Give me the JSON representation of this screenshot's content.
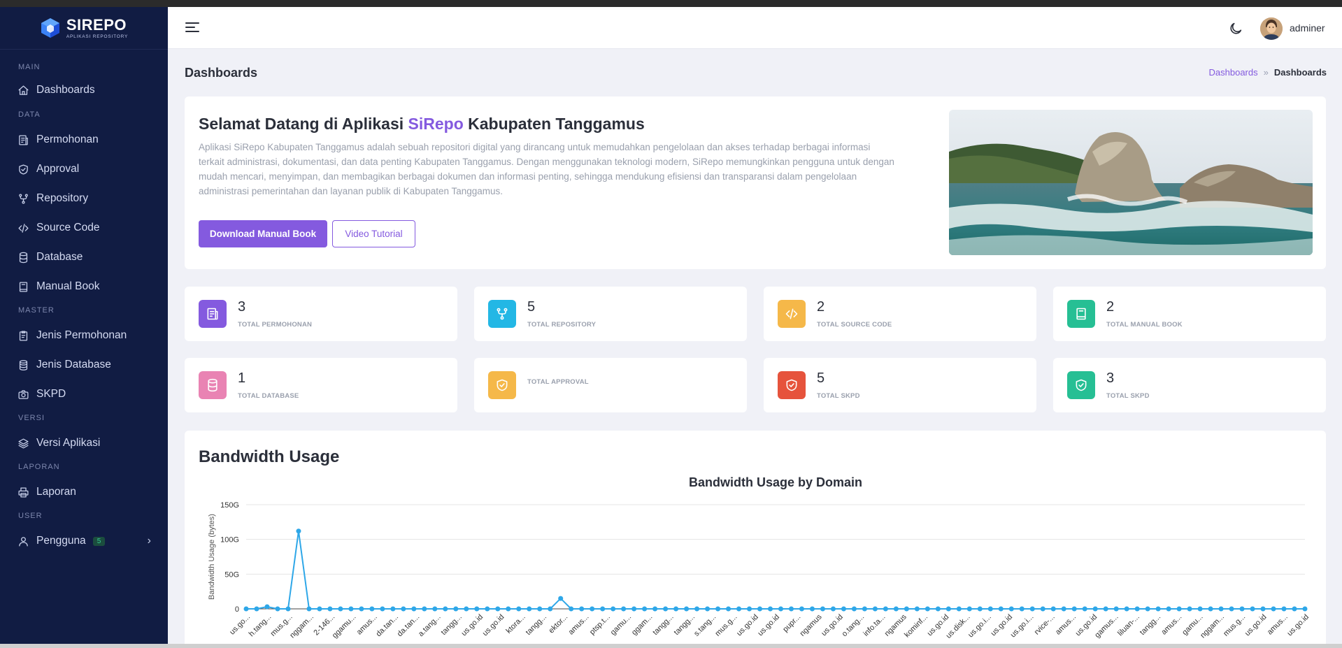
{
  "sidebar": {
    "brand": {
      "name": "SIREPO",
      "sub": "APLIKASI REPOSITORY"
    },
    "sections": {
      "main": "MAIN",
      "data": "DATA",
      "master": "MASTER",
      "versi": "VERSI",
      "laporan": "LAPORAN",
      "user": "USER"
    },
    "items": {
      "dashboards": "Dashboards",
      "permohonan": "Permohonan",
      "approval": "Approval",
      "repository": "Repository",
      "source_code": "Source Code",
      "database": "Database",
      "manual_book": "Manual Book",
      "jenis_permohonan": "Jenis Permohonan",
      "jenis_database": "Jenis Database",
      "skpd": "SKPD",
      "versi_aplikasi": "Versi Aplikasi",
      "laporan": "Laporan",
      "pengguna": "Pengguna"
    },
    "pengguna_badge": "5"
  },
  "header": {
    "username": "adminer"
  },
  "page": {
    "title": "Dashboards",
    "breadcrumb": {
      "link": "Dashboards",
      "separator": "»",
      "current": "Dashboards"
    }
  },
  "welcome": {
    "title_prefix": "Selamat Datang di Aplikasi ",
    "title_accent": "SiRepo",
    "title_suffix": " Kabupaten Tanggamus",
    "description": "Aplikasi SiRepo Kabupaten Tanggamus adalah sebuah repositori digital yang dirancang untuk memudahkan pengelolaan dan akses terhadap berbagai informasi terkait administrasi, dokumentasi, dan data penting Kabupaten Tanggamus. Dengan menggunakan teknologi modern, SiRepo memungkinkan pengguna untuk dengan mudah mencari, menyimpan, dan membagikan berbagai dokumen dan informasi penting, sehingga mendukung efisiensi dan transparansi dalam pengelolaan administrasi pemerintahan dan layanan publik di Kabupaten Tanggamus.",
    "download_button": "Download Manual Book",
    "video_button": "Video Tutorial"
  },
  "stats": [
    {
      "value": "3",
      "label": "TOTAL PERMOHONAN",
      "color": "#845adf",
      "icon": "file-text-icon"
    },
    {
      "value": "5",
      "label": "TOTAL REPOSITORY",
      "color": "#23b7e5",
      "icon": "git-fork-icon"
    },
    {
      "value": "2",
      "label": "TOTAL SOURCE CODE",
      "color": "#f5b849",
      "icon": "code-icon"
    },
    {
      "value": "2",
      "label": "TOTAL MANUAL BOOK",
      "color": "#26bf94",
      "icon": "book-icon"
    },
    {
      "value": "1",
      "label": "TOTAL DATABASE",
      "color": "#e983b3",
      "icon": "database-icon"
    },
    {
      "value": "",
      "label": "TOTAL APPROVAL",
      "color": "#f5b849",
      "icon": "shield-check-icon"
    },
    {
      "value": "5",
      "label": "TOTAL SKPD",
      "color": "#e6533c",
      "icon": "shield-check-icon"
    },
    {
      "value": "3",
      "label": "TOTAL SKPD",
      "color": "#26bf94",
      "icon": "shield-check-icon"
    }
  ],
  "chart_section": {
    "heading": "Bandwidth Usage"
  },
  "chart_data": {
    "type": "line",
    "title": "Bandwidth Usage by Domain",
    "xlabel": "",
    "ylabel": "Bandwidth Usage (bytes)",
    "yticks": [
      "0",
      "50G",
      "100G",
      "150G"
    ],
    "ylim": [
      0,
      150
    ],
    "unit": "G",
    "color": "#2ea7e8",
    "categories": [
      "us.go...",
      "h.tang...",
      "mus.g...",
      "nggam...",
      "2-146...",
      "ggamu...",
      "amus...",
      "da.tan...",
      "da.tan...",
      "a.tang...",
      "tangg...",
      "us.go.id",
      "us.go.id",
      "ktora...",
      "tangg...",
      "ektor...",
      "amus...",
      "ptsp.t...",
      "gamu...",
      "ggam...",
      "tangg...",
      "tangg...",
      "s.tang...",
      "mus.g...",
      "us.go.id",
      "us.go.id",
      "pupr...",
      "ngamus",
      "us.go.id",
      "o.tang...",
      "info.ta...",
      "ngamus",
      "kominf...",
      "us.go.id",
      "us.disk...",
      "us.go.i...",
      "us.go.id",
      "us.go.i...",
      "rvice-...",
      "amus...",
      "us.go.id",
      "gamus...",
      "liluan-...",
      "tangg...",
      "amus...",
      "gamu...",
      "nggam...",
      "mus.g...",
      "us.go.id",
      "amus...",
      "us.go.id"
    ],
    "values": [
      0,
      0,
      3,
      0,
      0,
      112,
      0,
      0,
      0,
      0,
      0,
      0,
      0,
      0,
      0,
      0,
      0,
      0,
      0,
      0,
      0,
      0,
      0,
      0,
      0,
      0,
      0,
      0,
      0,
      0,
      15,
      0,
      0,
      0,
      0,
      0,
      0,
      0,
      0,
      0,
      0,
      0,
      0,
      0,
      0,
      0,
      0,
      0,
      0,
      0,
      0,
      0,
      0,
      0,
      0,
      0,
      0,
      0,
      0,
      0,
      0,
      0,
      0,
      0,
      0,
      0,
      0,
      0,
      0,
      0,
      0,
      0,
      0,
      0,
      0,
      0,
      0,
      0,
      0,
      0,
      0,
      0,
      0,
      0,
      0,
      0,
      0,
      0,
      0,
      0,
      0,
      0,
      0,
      0,
      0,
      0,
      0,
      0,
      0,
      0,
      0,
      0
    ]
  }
}
